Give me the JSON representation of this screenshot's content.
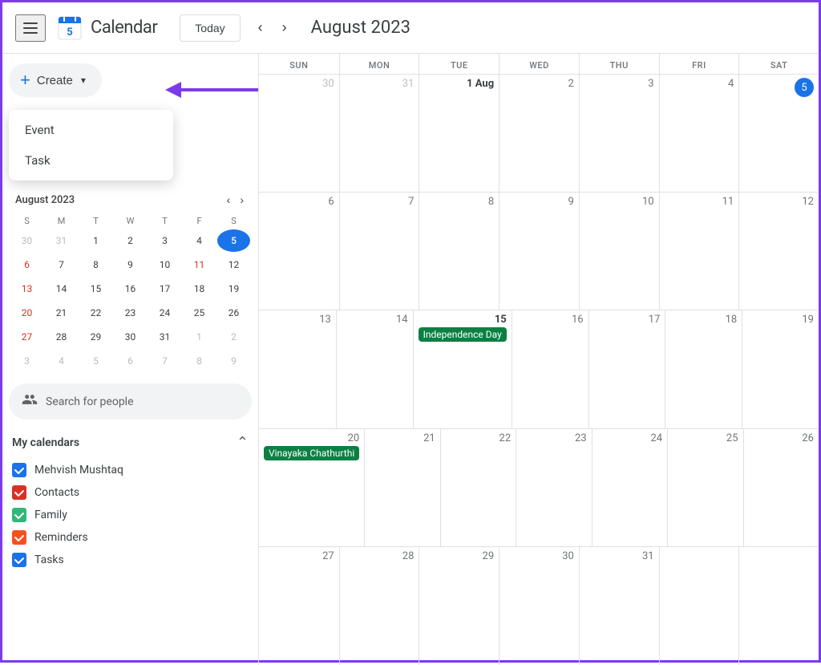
{
  "header": {
    "app_title": "Calendar",
    "today_label": "Today",
    "month_title": "August 2023"
  },
  "create_button": {
    "label": "Create",
    "plus": "+"
  },
  "dropdown": {
    "items": [
      "Event",
      "Task"
    ]
  },
  "mini_calendar": {
    "month_label": "August 2023",
    "day_headers": [
      "S",
      "M",
      "T",
      "W",
      "T",
      "F",
      "S"
    ],
    "weeks": [
      [
        {
          "num": "30",
          "cls": "other-month sunday"
        },
        {
          "num": "31",
          "cls": "other-month"
        },
        {
          "num": "1",
          "cls": ""
        },
        {
          "num": "2",
          "cls": ""
        },
        {
          "num": "3",
          "cls": ""
        },
        {
          "num": "4",
          "cls": ""
        },
        {
          "num": "5",
          "cls": "today"
        }
      ],
      [
        {
          "num": "6",
          "cls": "sunday"
        },
        {
          "num": "7",
          "cls": ""
        },
        {
          "num": "8",
          "cls": ""
        },
        {
          "num": "9",
          "cls": ""
        },
        {
          "num": "10",
          "cls": ""
        },
        {
          "num": "11",
          "cls": "red"
        },
        {
          "num": "12",
          "cls": ""
        }
      ],
      [
        {
          "num": "13",
          "cls": "sunday"
        },
        {
          "num": "14",
          "cls": ""
        },
        {
          "num": "15",
          "cls": ""
        },
        {
          "num": "16",
          "cls": ""
        },
        {
          "num": "17",
          "cls": ""
        },
        {
          "num": "18",
          "cls": ""
        },
        {
          "num": "19",
          "cls": ""
        }
      ],
      [
        {
          "num": "20",
          "cls": "sunday"
        },
        {
          "num": "21",
          "cls": ""
        },
        {
          "num": "22",
          "cls": ""
        },
        {
          "num": "23",
          "cls": ""
        },
        {
          "num": "24",
          "cls": ""
        },
        {
          "num": "25",
          "cls": ""
        },
        {
          "num": "26",
          "cls": ""
        }
      ],
      [
        {
          "num": "27",
          "cls": "sunday"
        },
        {
          "num": "28",
          "cls": ""
        },
        {
          "num": "29",
          "cls": ""
        },
        {
          "num": "30",
          "cls": ""
        },
        {
          "num": "31",
          "cls": ""
        },
        {
          "num": "1",
          "cls": "other-month"
        },
        {
          "num": "2",
          "cls": "other-month"
        }
      ],
      [
        {
          "num": "3",
          "cls": "sunday other-month"
        },
        {
          "num": "4",
          "cls": "other-month"
        },
        {
          "num": "5",
          "cls": "other-month"
        },
        {
          "num": "6",
          "cls": "other-month"
        },
        {
          "num": "7",
          "cls": "other-month"
        },
        {
          "num": "8",
          "cls": "other-month"
        },
        {
          "num": "9",
          "cls": "other-month"
        }
      ]
    ]
  },
  "search_people": {
    "placeholder": "Search for people"
  },
  "my_calendars": {
    "title": "My calendars",
    "items": [
      {
        "label": "Mehvish Mushtaq",
        "color": "#1a73e8",
        "checked": true
      },
      {
        "label": "Contacts",
        "color": "#d93025",
        "checked": true
      },
      {
        "label": "Family",
        "color": "#33b679",
        "checked": true
      },
      {
        "label": "Reminders",
        "color": "#f4511e",
        "checked": true
      },
      {
        "label": "Tasks",
        "color": "#1a73e8",
        "checked": true
      }
    ]
  },
  "main_calendar": {
    "day_headers": [
      "SUN",
      "MON",
      "TUE",
      "WED",
      "THU",
      "FRI",
      "SAT"
    ],
    "weeks": [
      [
        {
          "num": "30",
          "dim": true,
          "today": false
        },
        {
          "num": "31",
          "dim": true,
          "today": false
        },
        {
          "num": "1 Aug",
          "dim": false,
          "today": false,
          "bold": true
        },
        {
          "num": "2",
          "dim": false,
          "today": false
        },
        {
          "num": "3",
          "dim": false,
          "today": false
        },
        {
          "num": "4",
          "dim": false,
          "today": false
        },
        {
          "num": "5",
          "dim": false,
          "today": true
        }
      ],
      [
        {
          "num": "6",
          "dim": false,
          "today": false
        },
        {
          "num": "7",
          "dim": false,
          "today": false
        },
        {
          "num": "8",
          "dim": false,
          "today": false
        },
        {
          "num": "9",
          "dim": false,
          "today": false
        },
        {
          "num": "10",
          "dim": false,
          "today": false
        },
        {
          "num": "11",
          "dim": false,
          "today": false
        },
        {
          "num": "12",
          "dim": false,
          "today": false
        }
      ],
      [
        {
          "num": "13",
          "dim": false,
          "today": false
        },
        {
          "num": "14",
          "dim": false,
          "today": false
        },
        {
          "num": "15",
          "dim": false,
          "today": false,
          "event": {
            "label": "Independence Day",
            "cls": "event-teal"
          }
        },
        {
          "num": "16",
          "dim": false,
          "today": false
        },
        {
          "num": "17",
          "dim": false,
          "today": false
        },
        {
          "num": "18",
          "dim": false,
          "today": false
        },
        {
          "num": "19",
          "dim": false,
          "today": false
        }
      ],
      [
        {
          "num": "20",
          "dim": false,
          "today": false,
          "event": {
            "label": "Vinayaka Chathurthi",
            "cls": "event-teal"
          }
        },
        {
          "num": "21",
          "dim": false,
          "today": false
        },
        {
          "num": "22",
          "dim": false,
          "today": false
        },
        {
          "num": "23",
          "dim": false,
          "today": false
        },
        {
          "num": "24",
          "dim": false,
          "today": false
        },
        {
          "num": "25",
          "dim": false,
          "today": false
        },
        {
          "num": "26",
          "dim": false,
          "today": false
        }
      ],
      [
        {
          "num": "27",
          "dim": false,
          "today": false
        },
        {
          "num": "28",
          "dim": false,
          "today": false
        },
        {
          "num": "29",
          "dim": false,
          "today": false
        },
        {
          "num": "30",
          "dim": false,
          "today": false
        },
        {
          "num": "31",
          "dim": false,
          "today": false
        },
        {
          "num": "",
          "dim": true,
          "today": false
        },
        {
          "num": "",
          "dim": true,
          "today": false
        }
      ]
    ]
  }
}
